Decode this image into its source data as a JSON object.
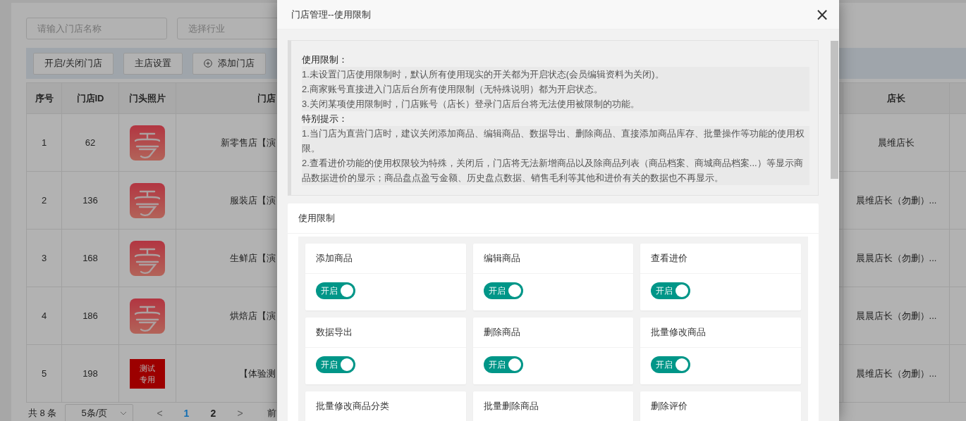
{
  "filters": [
    {
      "placeholder": "请输入门店名称"
    },
    {
      "placeholder": "选择行业"
    }
  ],
  "toolbar": [
    {
      "label": "开启/关闭门店",
      "kind": "plain"
    },
    {
      "label": "主店设置",
      "kind": "plain"
    },
    {
      "label": "添加门店",
      "kind": "add"
    }
  ],
  "table": {
    "columns": [
      "序号",
      "门店ID",
      "门头照片",
      "门店",
      "店长"
    ],
    "rows": [
      {
        "index": "1",
        "id": "62",
        "photo": {
          "kind": "logo"
        },
        "name": "新零售店【演",
        "manager": "晨维店长"
      },
      {
        "index": "2",
        "id": "136",
        "photo": {
          "kind": "logo"
        },
        "name": "服装店【演",
        "manager": "晨维店长（勿删）..."
      },
      {
        "index": "3",
        "id": "168",
        "photo": {
          "kind": "logo"
        },
        "name": "生鲜店【演",
        "manager": "晨晨店长（勿删）..."
      },
      {
        "index": "4",
        "id": "186",
        "photo": {
          "kind": "logo"
        },
        "name": "烘焙店【演",
        "manager": "晨晨店长（勿删）..."
      },
      {
        "index": "5",
        "id": "198",
        "photo": {
          "kind": "label",
          "text": "测试专用"
        },
        "name": "【体验测",
        "manager": "晨维店长（勿删）..."
      }
    ]
  },
  "pagination": {
    "total": "共 8 条",
    "page_size": "5条/页",
    "prev": "<",
    "pages": [
      {
        "label": "1",
        "selected": true
      },
      {
        "label": "2",
        "selected": false
      }
    ],
    "next": ">",
    "goto": "前"
  },
  "modal": {
    "title": "门店管理--使用限制",
    "close": "×",
    "notice": [
      {
        "kind": "heading",
        "text": "使用限制："
      },
      {
        "kind": "item",
        "text": "1.未设置门店使用限制时，默认所有使用现实的开关都为开启状态(会员编辑资料为关闭)。"
      },
      {
        "kind": "item",
        "text": "2.商家账号直接进入门店后台所有使用限制（无特殊说明）都为开启状态。"
      },
      {
        "kind": "item",
        "text": "3.关闭某项使用限制时，门店账号（店长）登录门店后台将无法使用被限制的功能。"
      },
      {
        "kind": "heading",
        "text": "特别提示："
      },
      {
        "kind": "item",
        "text": "1.当门店为直营门店时，建议关闭添加商品、编辑商品、数据导出、删除商品、直接添加商品库存、批量操作等功能的使用权限。"
      },
      {
        "kind": "item",
        "text": "2.查看进价功能的使用权限较为特殊，关闭后，门店将无法新增商品以及除商品列表（商品档案、商城商品档案...）等显示商品数据进价的显示；商品盘点盈亏金额、历史盘点数据、销售毛利等其他和进价有关的数据也不再显示。"
      }
    ],
    "section_title": "使用限制",
    "permissions": [
      {
        "label": "添加商品",
        "switch": {
          "text": "开启",
          "on": true
        }
      },
      {
        "label": "编辑商品",
        "switch": {
          "text": "开启",
          "on": true
        }
      },
      {
        "label": "查看进价",
        "switch": {
          "text": "开启",
          "on": true
        }
      },
      {
        "label": "数据导出",
        "switch": {
          "text": "开启",
          "on": true
        }
      },
      {
        "label": "删除商品",
        "switch": {
          "text": "开启",
          "on": true
        }
      },
      {
        "label": "批量修改商品",
        "switch": {
          "text": "开启",
          "on": true
        }
      },
      {
        "label": "批量修改商品分类"
      },
      {
        "label": "批量删除商品"
      },
      {
        "label": "删除评价"
      }
    ]
  }
}
